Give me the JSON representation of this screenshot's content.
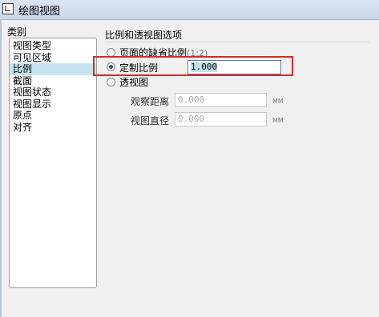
{
  "window": {
    "title": "绘图视图"
  },
  "categories": {
    "label": "类别",
    "items": [
      "视图类型",
      "可见区域",
      "比例",
      "截面",
      "视图状态",
      "视图显示",
      "原点",
      "对齐"
    ],
    "selected_index": 2
  },
  "scale_options": {
    "group_title": "比例和透视图选项",
    "default_scale_label": "页面的缺省比例",
    "default_scale_value": "(1:2)",
    "custom_scale_label": "定制比例",
    "custom_scale_value": "1.000",
    "perspective_label": "透视图",
    "viewing_distance_label": "观察距离",
    "viewing_distance_value": "0.000",
    "viewing_distance_unit": "MM",
    "view_diameter_label": "视图直径",
    "view_diameter_value": "0.000",
    "view_diameter_unit": "MM",
    "selected_option": "custom"
  },
  "colors": {
    "highlight": "#d42a2a",
    "selection": "#c4e3ee"
  }
}
